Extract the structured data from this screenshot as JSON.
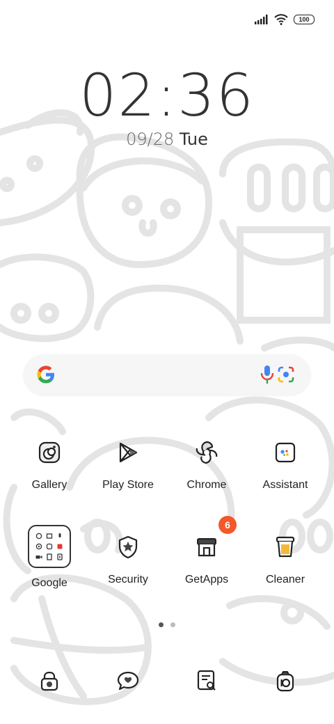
{
  "status_bar": {
    "battery": "100",
    "icons": [
      "signal-icon",
      "wifi-icon",
      "battery-icon"
    ]
  },
  "clock": {
    "time": "02:36",
    "date": "09/28",
    "day": "Tue"
  },
  "search_bar": {
    "icons": [
      "google-logo-icon",
      "mic-icon",
      "lens-camera-icon"
    ]
  },
  "apps_row1": [
    {
      "label": "Gallery",
      "icon": "gallery-icon"
    },
    {
      "label": "Play Store",
      "icon": "play-store-icon"
    },
    {
      "label": "Chrome",
      "icon": "chrome-icon"
    },
    {
      "label": "Assistant",
      "icon": "assistant-icon"
    }
  ],
  "apps_row2": [
    {
      "label": "Google",
      "icon": "google-folder-icon"
    },
    {
      "label": "Security",
      "icon": "security-icon"
    },
    {
      "label": "GetApps",
      "icon": "getapps-icon",
      "badge": "6"
    },
    {
      "label": "Cleaner",
      "icon": "cleaner-icon"
    }
  ],
  "page_indicator": {
    "pages": 2,
    "active": 0
  },
  "dock": [
    {
      "icon": "phone-lock-icon"
    },
    {
      "icon": "messages-icon"
    },
    {
      "icon": "notes-icon"
    },
    {
      "icon": "camera-icon"
    }
  ],
  "colors": {
    "badge": "#f2582a",
    "text": "#222222",
    "wallpaper_lines": "#e2e2e2"
  }
}
